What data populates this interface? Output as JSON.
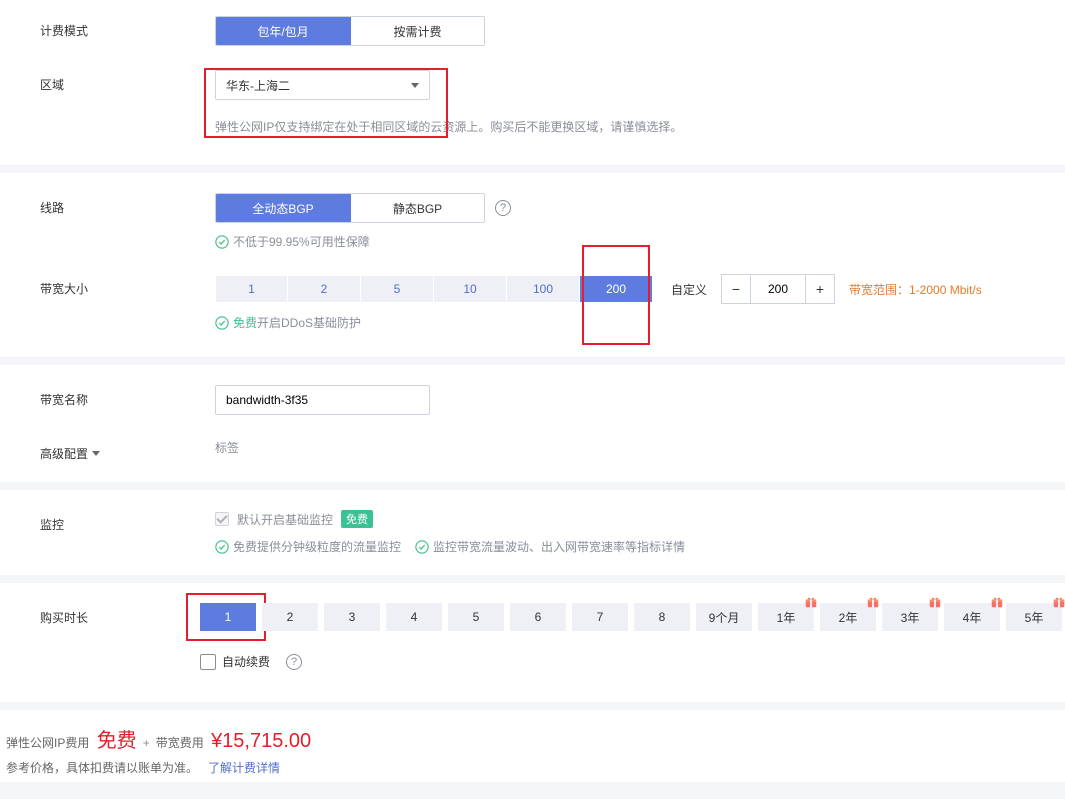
{
  "billing": {
    "label": "计费模式",
    "opt1": "包年/包月",
    "opt2": "按需计费"
  },
  "region": {
    "label": "区域",
    "selected": "华东-上海二",
    "hint": "弹性公网IP仅支持绑定在处于相同区域的云资源上。购买后不能更换区域，请谨慎选择。"
  },
  "line": {
    "label": "线路",
    "opt1": "全动态BGP",
    "opt2": "静态BGP",
    "sla": "不低于99.95%可用性保障"
  },
  "bandwidth": {
    "label": "带宽大小",
    "presets": [
      "1",
      "2",
      "5",
      "10",
      "100",
      "200"
    ],
    "active_index": 5,
    "custom_label": "自定义",
    "value": "200",
    "range_hint": "带宽范围：1-2000 Mbit/s",
    "ddos_prefix": "免费",
    "ddos_text": "开启DDoS基础防护"
  },
  "bw_name": {
    "label": "带宽名称",
    "value": "bandwidth-3f35"
  },
  "advanced": {
    "label": "高级配置",
    "tag": "标签"
  },
  "monitor": {
    "label": "监控",
    "default_text": "默认开启基础监控",
    "free_tag": "免费",
    "hint1": "免费提供分钟级粒度的流量监控",
    "hint2": "监控带宽流量波动、出入网带宽速率等指标详情"
  },
  "duration": {
    "label": "购买时长",
    "items": [
      "1",
      "2",
      "3",
      "4",
      "5",
      "6",
      "7",
      "8",
      "9个月",
      "1年",
      "2年",
      "3年",
      "4年",
      "5年"
    ],
    "active_index": 0,
    "gift_from_index": 9,
    "renew_label": "自动续费"
  },
  "footer": {
    "eip_label": "弹性公网IP费用",
    "eip_free": "免费",
    "bw_label": "带宽费用",
    "price": "¥15,715.00",
    "ref_text": "参考价格，具体扣费请以账单为准。",
    "link": "了解计费详情"
  }
}
